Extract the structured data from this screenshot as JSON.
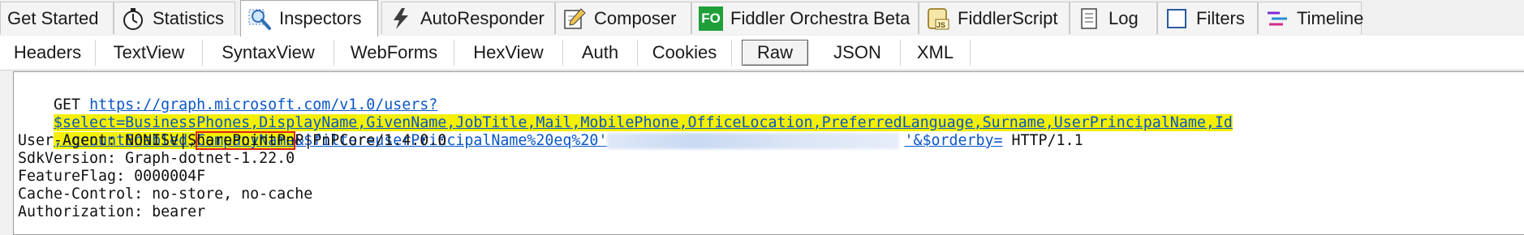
{
  "top_tabs": [
    {
      "label": "Get Started",
      "icon": ""
    },
    {
      "label": "Statistics",
      "icon": "stopwatch-icon"
    },
    {
      "label": "Inspectors",
      "icon": "magnifier-icon"
    },
    {
      "label": "AutoResponder",
      "icon": "lightning-icon"
    },
    {
      "label": "Composer",
      "icon": "pencil-icon"
    },
    {
      "label": "Fiddler Orchestra Beta",
      "icon": "fo-badge-icon",
      "badge_text": "FO"
    },
    {
      "label": "FiddlerScript",
      "icon": "script-icon",
      "badge_text": "JS"
    },
    {
      "label": "Log",
      "icon": "log-icon"
    },
    {
      "label": "Filters",
      "icon": "checkbox-icon"
    },
    {
      "label": "Timeline",
      "icon": "timeline-icon"
    }
  ],
  "active_top_tab": "Inspectors",
  "sub_tabs": [
    "Headers",
    "TextView",
    "SyntaxView",
    "WebForms",
    "HexView",
    "Auth",
    "Cookies",
    "Raw",
    "JSON",
    "XML"
  ],
  "active_sub_tab": "Raw",
  "request": {
    "method": "GET ",
    "url_part1": "https://graph.microsoft.com/v1.0/users?",
    "url_part2": "$select=BusinessPhones,DisplayName,GivenName,JobTitle,Mail,MobilePhone,OfficeLocation,PreferredLanguage,Surname,UserPrincipalName,Id",
    "url_part3a": ",AccountEnabled,",
    "url_part3_boxed": "CompanyName",
    "url_part3b": "&$filter=userPrincipalName%20eq%20'",
    "url_part3c": "'&$orderby=",
    "protocol": " HTTP/1.1",
    "headers": [
      "User-Agent: NONISV|SharePointPnP|PnPCore/1.4.0.0",
      "SdkVersion: Graph-dotnet-1.22.0",
      "FeatureFlag: 0000004F",
      "Cache-Control: no-store, no-cache",
      "Authorization: bearer"
    ]
  },
  "colors": {
    "link": "#0a56c8",
    "highlight": "#f4f000",
    "annotation_box": "#e02020"
  }
}
